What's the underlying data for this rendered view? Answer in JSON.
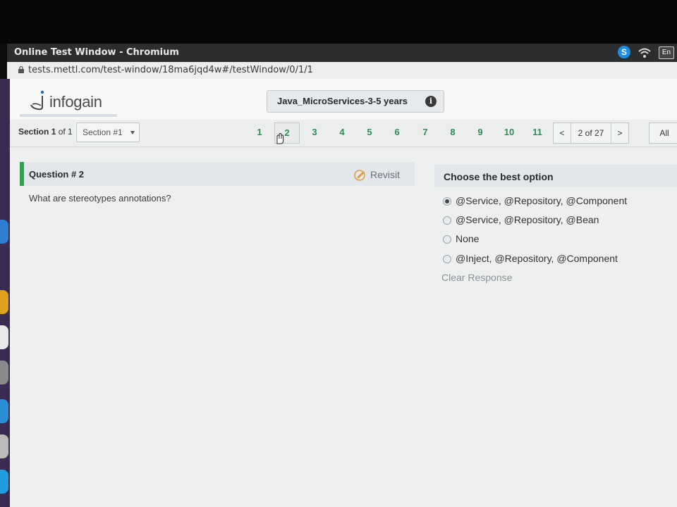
{
  "window": {
    "title": "Online Test Window - Chromium",
    "language": "En"
  },
  "browser": {
    "url": "tests.mettl.com/test-window/18ma6jqd4w#/testWindow/0/1/1"
  },
  "header": {
    "logo_text": "infogain",
    "test_name": "Java_MicroServices-3-5 years"
  },
  "nav": {
    "section_label": "Section",
    "section_number": "1",
    "section_of": "of 1",
    "section_select": "Section #1",
    "questions": [
      "1",
      "2",
      "3",
      "4",
      "5",
      "6",
      "7",
      "8",
      "9",
      "10",
      "11"
    ],
    "current_question": "2",
    "prev": "<",
    "page_info": "2 of 27",
    "next": ">",
    "all": "All"
  },
  "question": {
    "title": "Question # 2",
    "revisit": "Revisit",
    "text": "What are stereotypes annotations?"
  },
  "answer": {
    "title": "Choose the best option",
    "options": [
      {
        "label": "@Service, @Repository, @Component"
      },
      {
        "label": "@Service, @Repository, @Bean"
      },
      {
        "label": "None"
      },
      {
        "label": "@Inject, @Repository, @Component"
      }
    ],
    "selected_index": 0,
    "clear": "Clear Response"
  },
  "colors": {
    "accent_green": "#2fa04e",
    "question_number": "#2c8c5a",
    "panel_header": "#e2e7ec"
  }
}
